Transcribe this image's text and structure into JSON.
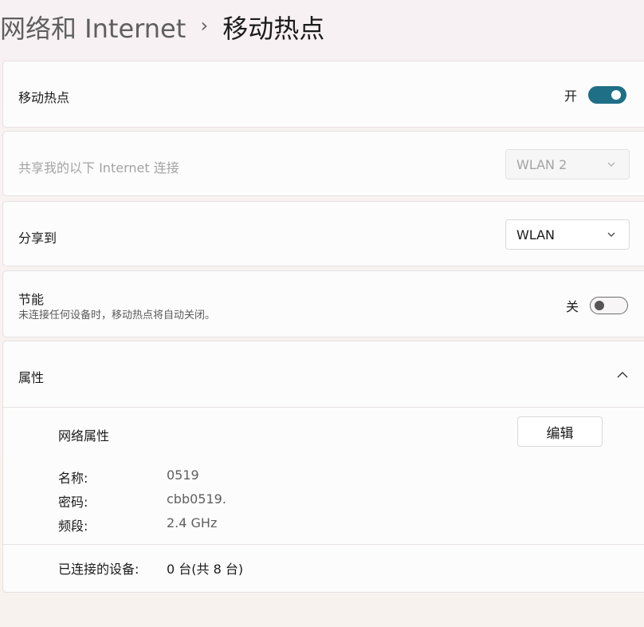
{
  "breadcrumb": {
    "parent": "网络和 Internet",
    "separator": "›",
    "current": "移动热点"
  },
  "hotspot": {
    "label": "移动热点",
    "state_text": "开",
    "enabled": true
  },
  "share_from": {
    "label": "共享我的以下 Internet 连接",
    "selected": "WLAN 2",
    "disabled": true
  },
  "share_to": {
    "label": "分享到",
    "selected": "WLAN"
  },
  "power_saving": {
    "label": "节能",
    "description": "未连接任何设备时，移动热点将自动关闭。",
    "state_text": "关",
    "enabled": false
  },
  "properties": {
    "label": "属性",
    "expanded": true,
    "network_props_label": "网络属性",
    "edit_label": "编辑",
    "name_label": "名称:",
    "name_value": "0519",
    "password_label": "密码:",
    "password_value": "cbb0519.",
    "band_label": "频段:",
    "band_value": "2.4 GHz",
    "connected_label": "已连接的设备:",
    "connected_value": "0 台(共 8 台)"
  },
  "icons": {
    "dropdown": "chevron-down-icon",
    "collapse": "chevron-up-icon"
  },
  "colors": {
    "accent": "#1f6f86"
  }
}
